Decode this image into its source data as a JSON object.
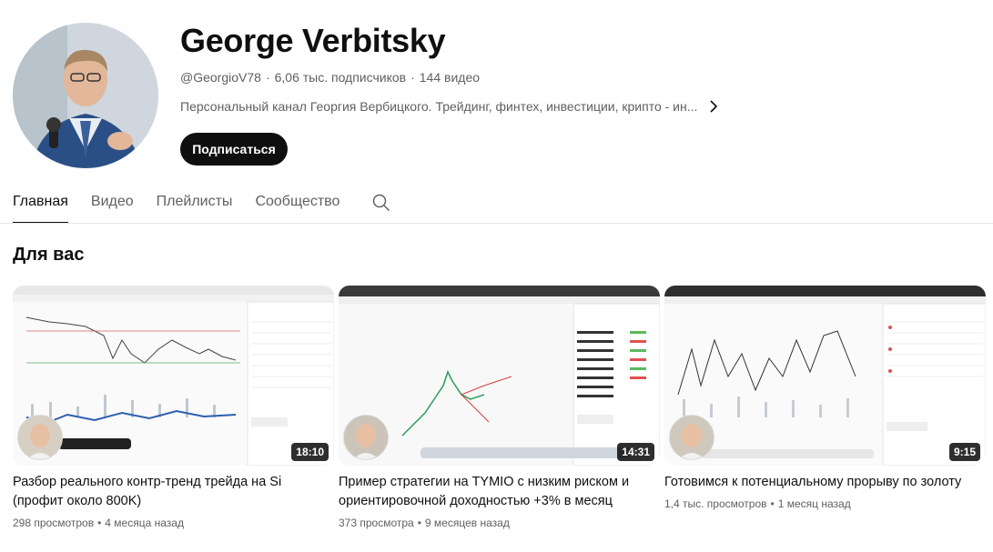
{
  "channel": {
    "name": "George Verbitsky",
    "handle": "@GeorgioV78",
    "subscribers": "6,06 тыс. подписчиков",
    "video_count": "144 видео",
    "description": "Персональный канал Георгия Вербицкого. Трейдинг, финтех, инвестиции, крипто - ин...",
    "subscribe_label": "Подписаться"
  },
  "tabs": [
    {
      "label": "Главная",
      "active": true
    },
    {
      "label": "Видео",
      "active": false
    },
    {
      "label": "Плейлисты",
      "active": false
    },
    {
      "label": "Сообщество",
      "active": false
    }
  ],
  "section": {
    "title": "Для вас"
  },
  "videos": [
    {
      "title": "Разбор реального контр-тренд трейда на Si (профит около 800K)",
      "duration": "18:10",
      "views": "298 просмотров",
      "age": "4 месяца назад"
    },
    {
      "title": "Пример стратегии на TYMIO с низким риском и ориентировочной доходностью +3% в месяц",
      "duration": "14:31",
      "views": "373 просмотра",
      "age": "9 месяцев назад"
    },
    {
      "title": "Готовимся к потенциальному прорыву по золоту",
      "duration": "9:15",
      "views": "1,4 тыс. просмотров",
      "age": "1 месяц назад"
    }
  ],
  "icons": {
    "search": "search-icon",
    "more": "chevron-right-icon"
  },
  "colors": {
    "subscribe_bg": "#0f0f0f",
    "meta_text": "#606060"
  }
}
